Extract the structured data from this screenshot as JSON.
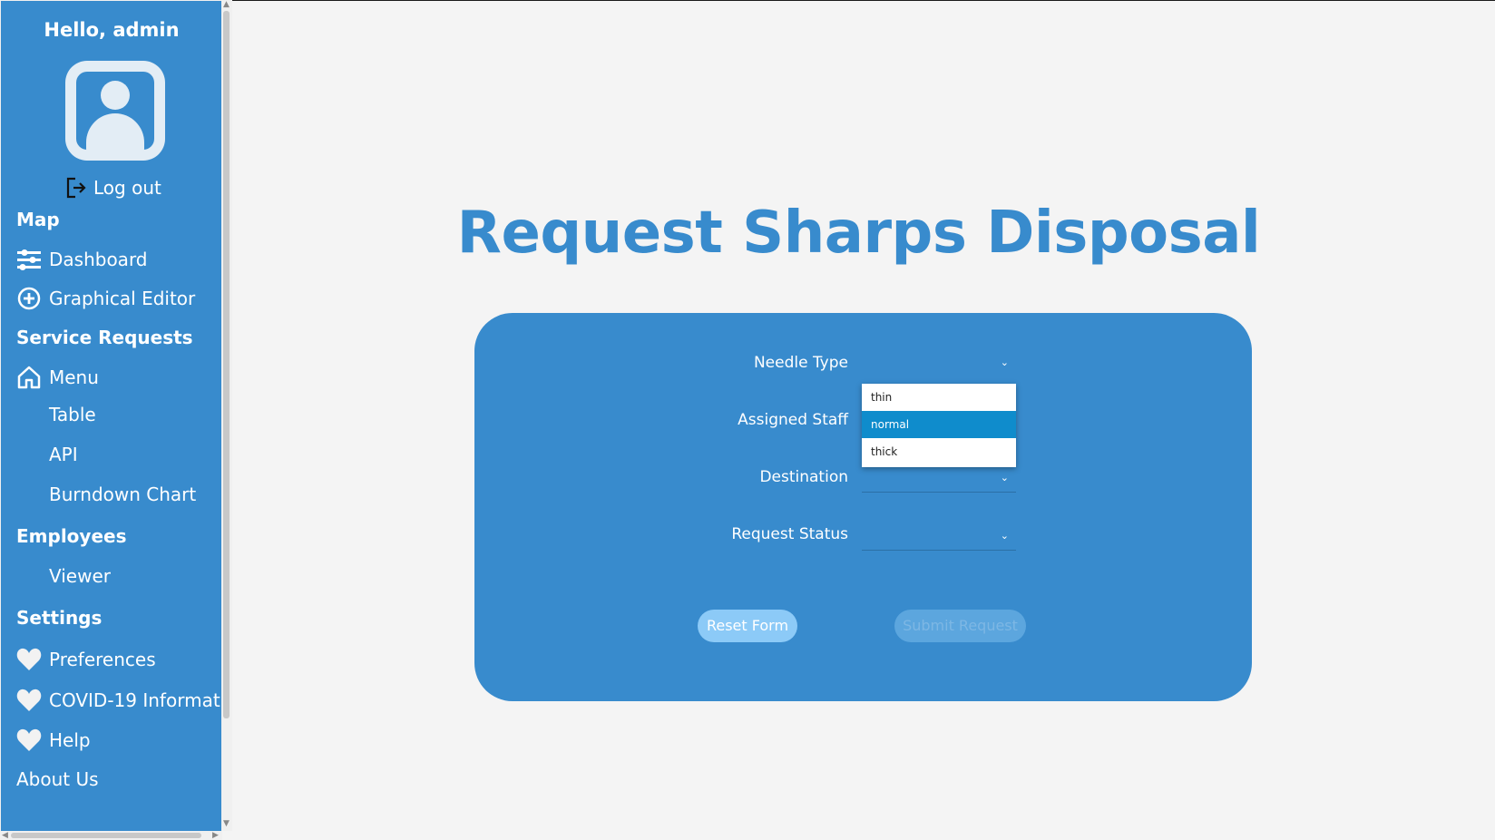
{
  "sidebar": {
    "greeting": "Hello, admin",
    "logout_label": "Log out",
    "sections": {
      "map": "Map",
      "service_requests": "Service Requests",
      "employees": "Employees",
      "settings": "Settings"
    },
    "items": {
      "dashboard": "Dashboard",
      "graphical_editor": "Graphical Editor",
      "menu": "Menu",
      "table": "Table",
      "api": "API",
      "burndown_chart": "Burndown Chart",
      "viewer": "Viewer",
      "preferences": "Preferences",
      "covid": "COVID-19 Informati...",
      "help": "Help",
      "about_us": "About Us"
    }
  },
  "main": {
    "title": "Request Sharps Disposal",
    "form": {
      "needle_type_label": "Needle Type",
      "assigned_staff_label": "Assigned Staff",
      "destination_label": "Destination",
      "request_status_label": "Request Status",
      "needle_type_options": [
        "thin",
        "normal",
        "thick"
      ],
      "needle_type_highlighted": "normal",
      "reset_label": "Reset Form",
      "submit_label": "Submit Request"
    }
  },
  "colors": {
    "primary": "#388bcd",
    "background": "#f4f4f4",
    "highlight": "#0f8ccc",
    "reset_button": "#8ccaf7"
  },
  "icons": {
    "logout": "logout-icon",
    "dashboard": "sliders-icon",
    "graphical_editor": "plus-circle-icon",
    "menu": "home-icon",
    "preferences": "heart-icon",
    "covid": "heart-icon",
    "help": "heart-icon"
  }
}
